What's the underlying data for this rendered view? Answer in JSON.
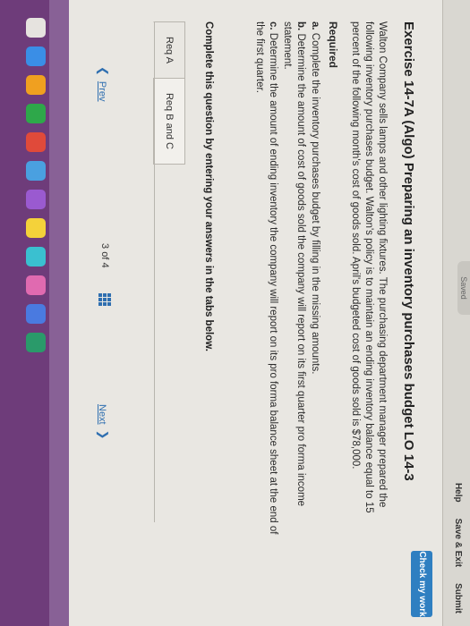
{
  "status": {
    "saved": "Saved"
  },
  "topnav": {
    "help": "Help",
    "save_exit": "Save & Exit",
    "submit": "Submit"
  },
  "check_button": "Check my work",
  "exercise": {
    "title": "Exercise 14-7A (Algo) Preparing an inventory purchases budget LO 14-3",
    "description": "Walton Company sells lamps and other lighting fixtures. The purchasing department manager prepared the following inventory purchases budget. Walton's policy is to maintain an ending inventory balance equal to 15 percent of the following month's cost of goods sold. April's budgeted cost of goods sold is $78,000.",
    "required_heading": "Required",
    "requirements": [
      {
        "letter": "a.",
        "text": "Complete the inventory purchases budget by filling in the missing amounts."
      },
      {
        "letter": "b.",
        "text": "Determine the amount of cost of goods sold the company will report on its first quarter pro forma income statement."
      },
      {
        "letter": "c.",
        "text": "Determine the amount of ending inventory the company will report on its pro forma balance sheet at the end of the first quarter."
      }
    ]
  },
  "instruction": "Complete this question by entering your answers in the tabs below.",
  "tabs": [
    {
      "label": "Req A"
    },
    {
      "label": "Req B and C"
    }
  ],
  "pager": {
    "prev": "Prev",
    "page_current": "3",
    "page_of": "of",
    "page_total": "4",
    "next": "Next"
  },
  "icons": {
    "prev": "chevron-left-icon",
    "next": "chevron-right-icon",
    "grid": "grid-icon"
  },
  "colors": {
    "accent": "#2f7fc1",
    "link": "#2f6fb0",
    "dock": "#6e3c7a"
  }
}
